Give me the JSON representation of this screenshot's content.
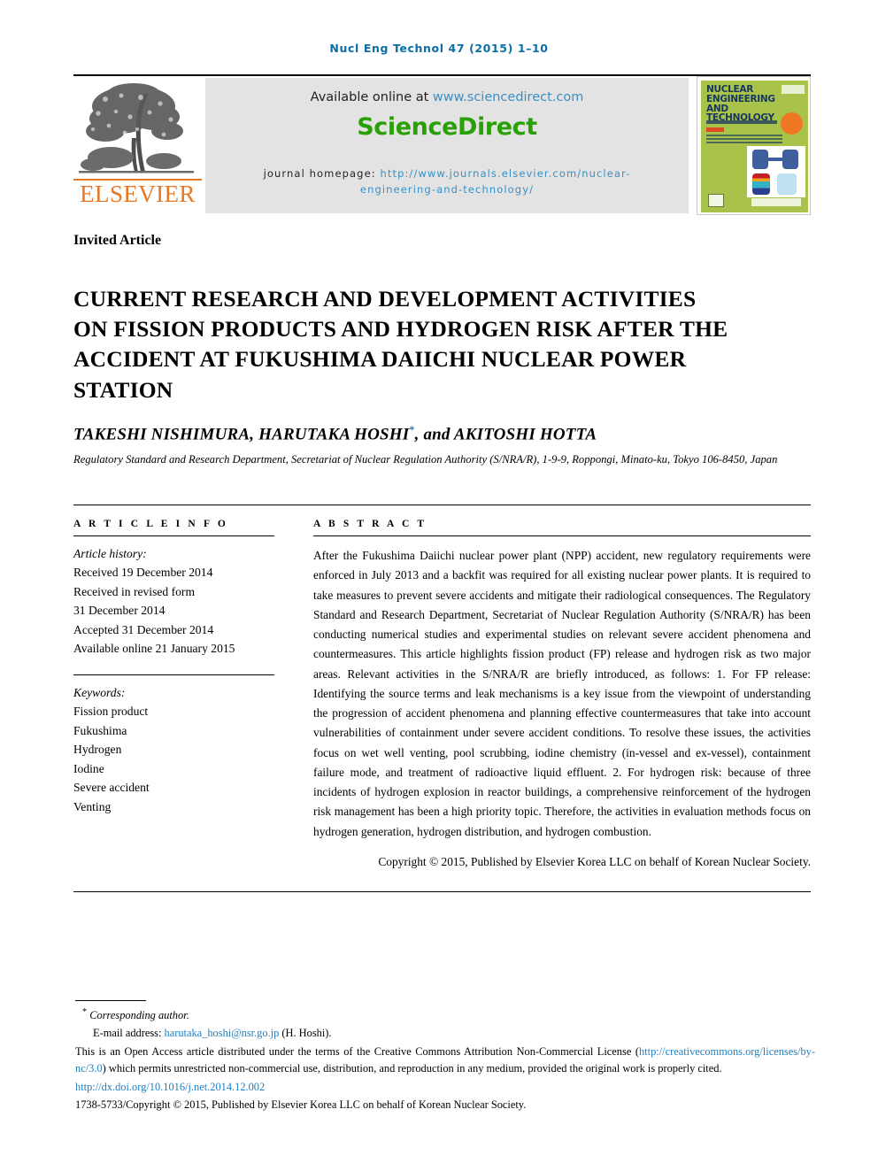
{
  "running_head": "Nucl Eng Technol 47 (2015) 1–10",
  "masthead": {
    "publisher_name": "ELSEVIER",
    "available_prefix": "Available online at ",
    "available_link": "www.sciencedirect.com",
    "sciencedirect_logo": "ScienceDirect",
    "homepage_label": "journal homepage: ",
    "homepage_link_line1": "http://www.journals.elsevier.com/nuclear-",
    "homepage_link_line2": "engineering-and-technology/",
    "cover": {
      "title_line1": "NUCLEAR",
      "title_line2": "ENGINEERING AND",
      "title_line3": "TECHNOLOGY"
    }
  },
  "article": {
    "type": "Invited Article",
    "title": "CURRENT RESEARCH AND DEVELOPMENT ACTIVITIES ON FISSION PRODUCTS AND HYDROGEN RISK AFTER THE ACCIDENT AT FUKUSHIMA DAIICHI NUCLEAR POWER STATION",
    "authors_pre": "TAKESHI NISHIMURA, HARUTAKA HOSHI",
    "authors_star": "*",
    "authors_post": ", and AKITOSHI HOTTA",
    "affiliation": "Regulatory Standard and Research Department, Secretariat of Nuclear Regulation Authority (S/NRA/R), 1-9-9, Roppongi, Minato-ku, Tokyo 106-8450, Japan"
  },
  "info": {
    "heading": "A R T I C L E   I N F O",
    "history_label": "Article history:",
    "history": [
      "Received 19 December 2014",
      "Received in revised form",
      "31 December 2014",
      "Accepted 31 December 2014",
      "Available online 21 January 2015"
    ],
    "keywords_label": "Keywords:",
    "keywords": [
      "Fission product",
      "Fukushima",
      "Hydrogen",
      "Iodine",
      "Severe accident",
      "Venting"
    ]
  },
  "abstract": {
    "heading": "A B S T R A C T",
    "body": "After the Fukushima Daiichi nuclear power plant (NPP) accident, new regulatory requirements were enforced in July 2013 and a backfit was required for all existing nuclear power plants. It is required to take measures to prevent severe accidents and mitigate their radiological consequences. The Regulatory Standard and Research Department, Secretariat of Nuclear Regulation Authority (S/NRA/R) has been conducting numerical studies and experimental studies on relevant severe accident phenomena and countermeasures. This article highlights fission product (FP) release and hydrogen risk as two major areas. Relevant activities in the S/NRA/R are briefly introduced, as follows: 1. For FP release: Identifying the source terms and leak mechanisms is a key issue from the viewpoint of understanding the progression of accident phenomena and planning effective countermeasures that take into account vulnerabilities of containment under severe accident conditions. To resolve these issues, the activities focus on wet well venting, pool scrubbing, iodine chemistry (in-vessel and ex-vessel), containment failure mode, and treatment of radioactive liquid effluent. 2. For hydrogen risk: because of three incidents of hydrogen explosion in reactor buildings, a comprehensive reinforcement of the hydrogen risk management has been a high priority topic. Therefore, the activities in evaluation methods focus on hydrogen generation, hydrogen distribution, and hydrogen combustion.",
    "copyright": "Copyright © 2015, Published by Elsevier Korea LLC on behalf of Korean Nuclear Society."
  },
  "footnotes": {
    "corresponding_star": "*",
    "corresponding": " Corresponding author.",
    "email_label": "E-mail address: ",
    "email": "harutaka_hoshi@nsr.go.jp",
    "email_suffix": " (H. Hoshi).",
    "license_pre": " This is an Open Access article distributed under the terms of the Creative Commons Attribution Non-Commercial License (",
    "license_link": "http://creativecommons.org/licenses/by-nc/3.0",
    "license_post": ") which permits unrestricted non-commercial use, distribution, and reproduction in any medium, provided the original work is properly cited.",
    "doi": "http://dx.doi.org/10.1016/j.net.2014.12.002",
    "issn_line": "1738-5733/Copyright © 2015, Published by Elsevier Korea LLC on behalf of Korean Nuclear Society."
  },
  "colors": {
    "link": "#1f7fc0",
    "running_head": "#0a6ea8",
    "sciencedirect_green": "#2aa007",
    "elsevier_orange": "#e87722",
    "cover_green": "#a9c34a",
    "band_gray": "#e3e3e3"
  }
}
